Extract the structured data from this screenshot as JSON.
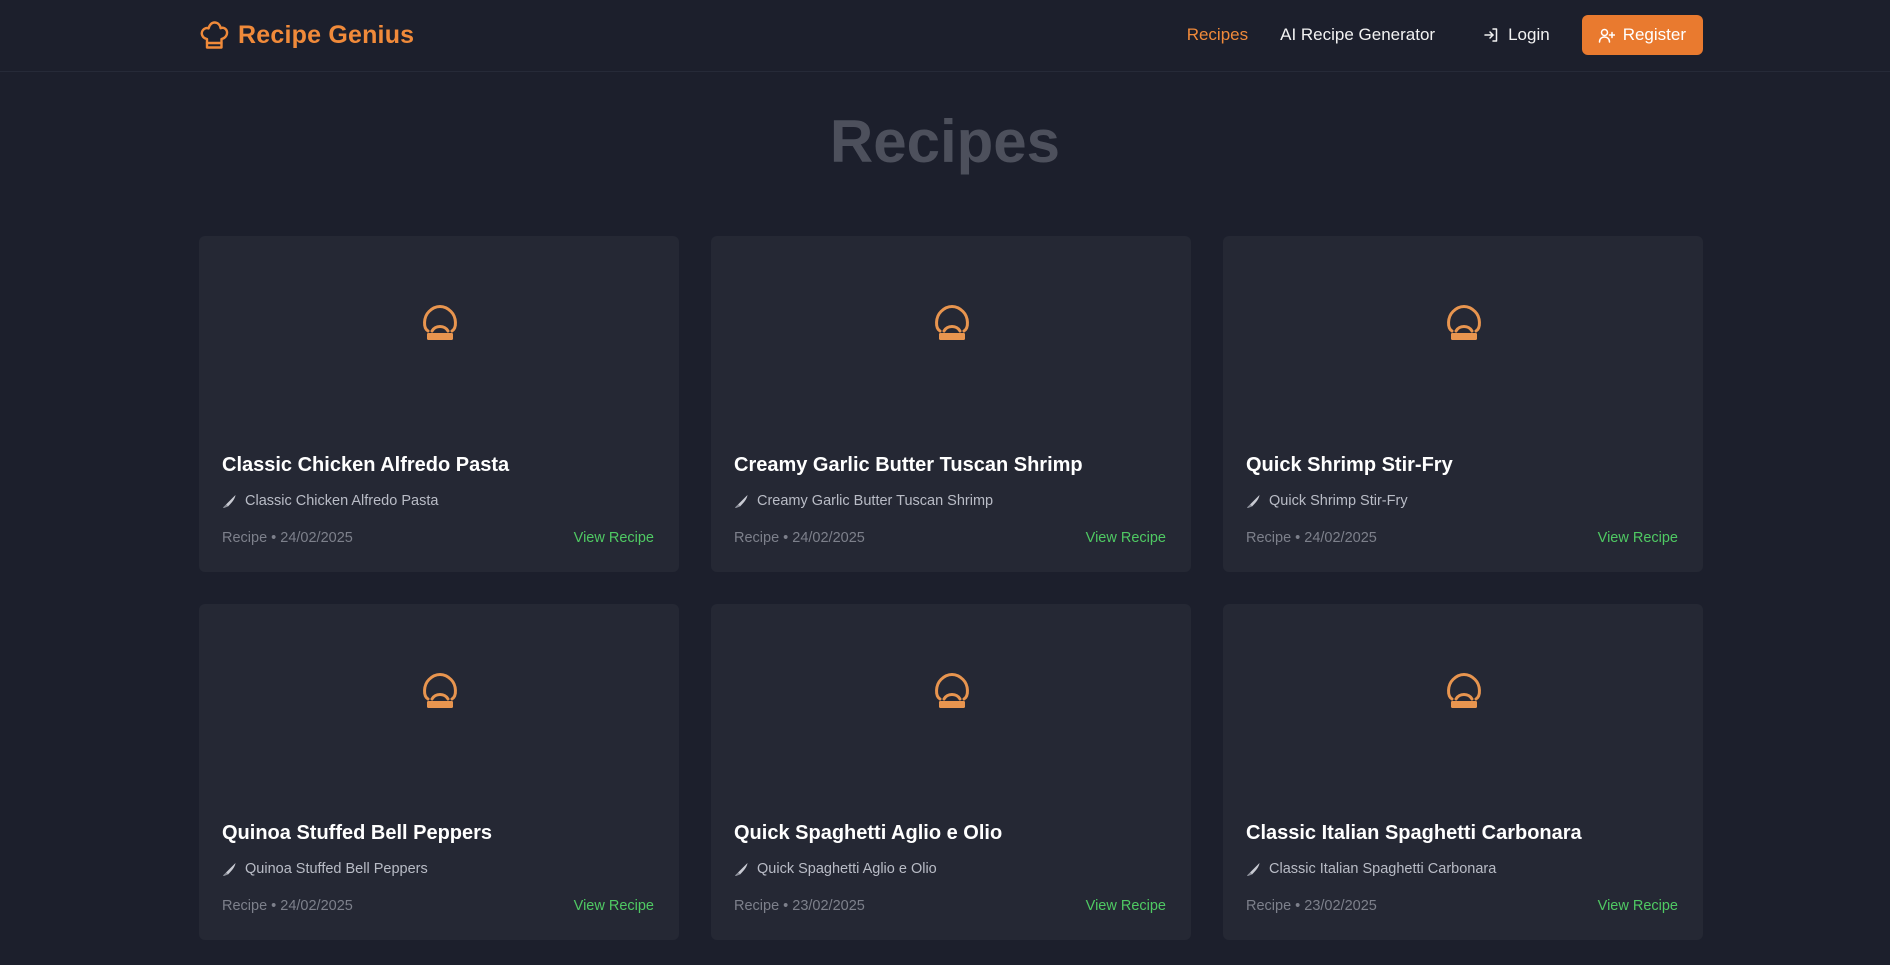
{
  "header": {
    "brand": "Recipe Genius",
    "brand_icon": "chef-hat-icon",
    "nav": {
      "recipes": "Recipes",
      "ai_generator": "AI Recipe Generator",
      "login": "Login",
      "register": "Register"
    }
  },
  "page": {
    "title": "Recipes"
  },
  "recipes": [
    {
      "title": "Classic Chicken Alfredo Pasta",
      "subtitle": "Classic Chicken Alfredo Pasta",
      "meta": "Recipe • 24/02/2025",
      "link": "View Recipe"
    },
    {
      "title": "Creamy Garlic Butter Tuscan Shrimp",
      "subtitle": "Creamy Garlic Butter Tuscan Shrimp",
      "meta": "Recipe • 24/02/2025",
      "link": "View Recipe"
    },
    {
      "title": "Quick Shrimp Stir-Fry",
      "subtitle": "Quick Shrimp Stir-Fry",
      "meta": "Recipe • 24/02/2025",
      "link": "View Recipe"
    },
    {
      "title": "Quinoa Stuffed Bell Peppers",
      "subtitle": "Quinoa Stuffed Bell Peppers",
      "meta": "Recipe • 24/02/2025",
      "link": "View Recipe"
    },
    {
      "title": "Quick Spaghetti Aglio e Olio",
      "subtitle": "Quick Spaghetti Aglio e Olio",
      "meta": "Recipe • 23/02/2025",
      "link": "View Recipe"
    },
    {
      "title": "Classic Italian Spaghetti Carbonara",
      "subtitle": "Classic Italian Spaghetti Carbonara",
      "meta": "Recipe • 23/02/2025",
      "link": "View Recipe"
    }
  ],
  "colors": {
    "accent": "#f08a3a",
    "button": "#e97a2f",
    "link": "#4fc963",
    "background": "#1c1f2c",
    "card": "#252834"
  }
}
